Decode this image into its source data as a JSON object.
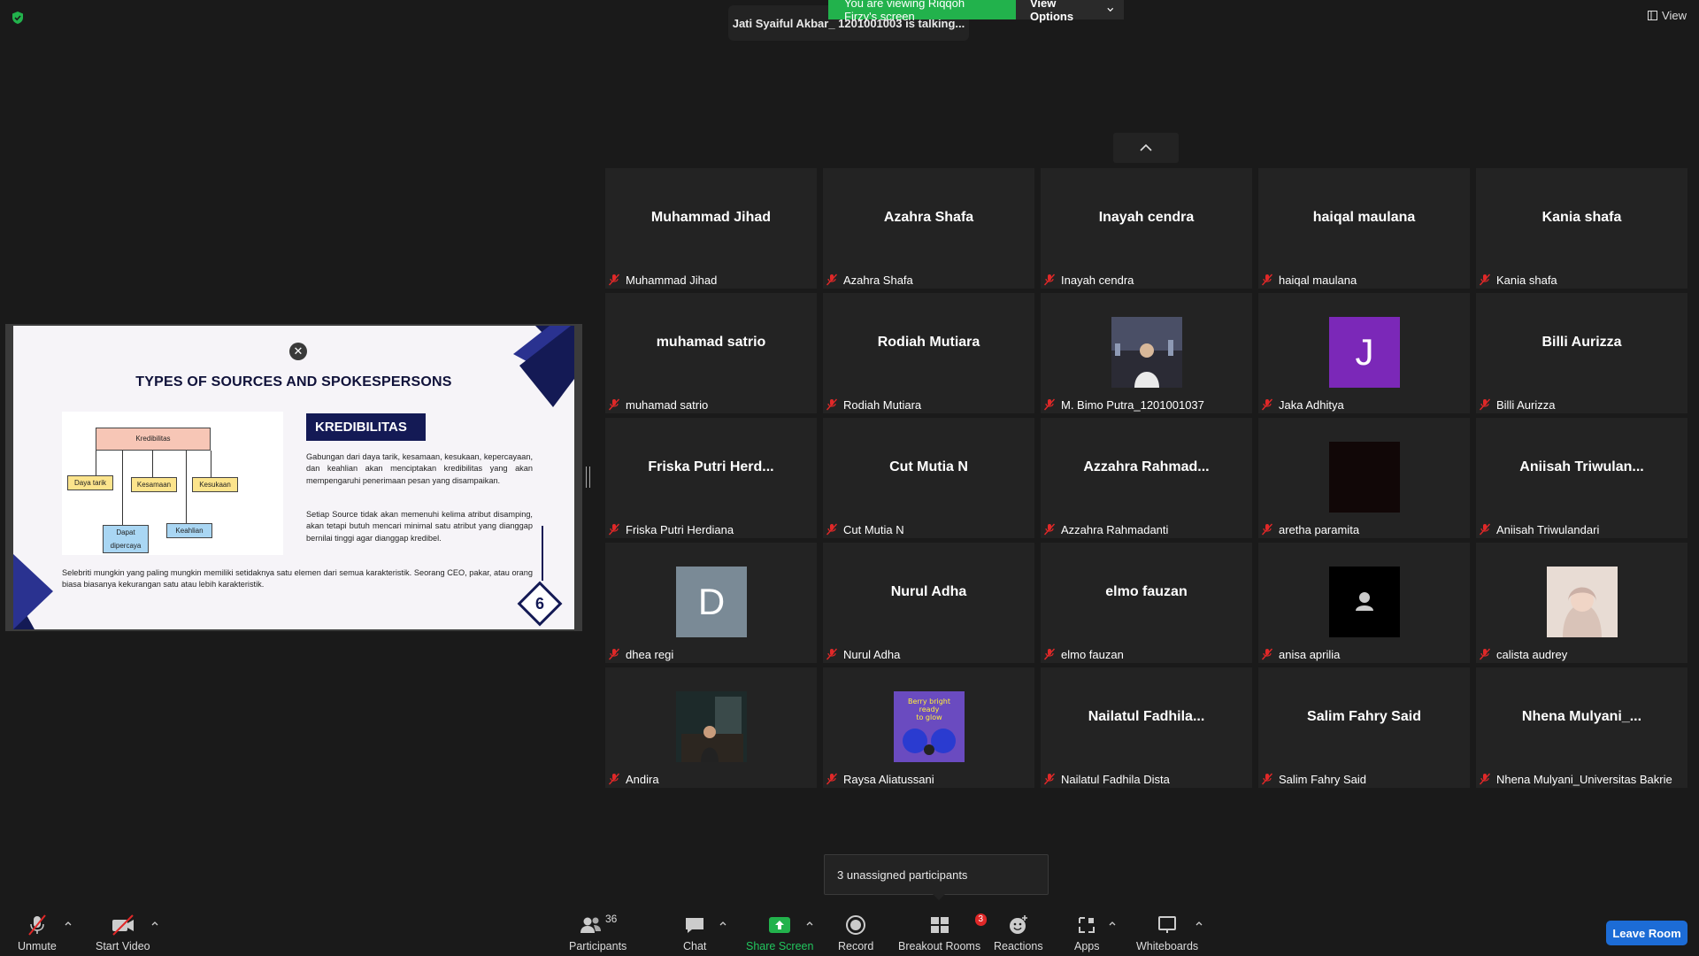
{
  "top": {
    "viewing_text": "You are viewing Riqqoh Firzy's screen",
    "view_options": "View Options",
    "talking_text": "Jati Syaiful Akbar_ 1201001003 is talking...",
    "view_label": "View"
  },
  "slide": {
    "title": "TYPES OF SOURCES AND SPOKESPERSONS",
    "heading": "KREDIBILITAS",
    "para1": "Gabungan dari daya tarik, kesamaan, kesukaan, kepercayaan, dan keahlian akan menciptakan kredibilitas yang akan mempengaruhi penerimaan pesan yang disampaikan.",
    "para2": "Setiap Source tidak akan memenuhi kelima atribut disamping, akan tetapi butuh mencari minimal satu atribut yang dianggap bernilai tinggi agar dianggap kredibel.",
    "bottom": "Selebriti mungkin yang paling mungkin memiliki setidaknya satu elemen dari semua karakteristik. Seorang CEO, pakar, atau orang biasa biasanya kekurangan satu atau lebih karakteristik.",
    "page": "6",
    "diagram": {
      "root": "Kredibilitas",
      "daya_tarik": "Daya tarik",
      "kesamaan": "Kesamaan",
      "kesukaan": "Kesukaan",
      "dapat_dipercaya": "Dapat dipercaya",
      "keahlian": "Keahlian"
    }
  },
  "participants": [
    {
      "big": "Muhammad Jihad",
      "label": "Muhammad Jihad"
    },
    {
      "big": "Azahra Shafa",
      "label": "Azahra Shafa"
    },
    {
      "big": "Inayah cendra",
      "label": "Inayah cendra"
    },
    {
      "big": "haiqal maulana",
      "label": "haiqal maulana"
    },
    {
      "big": "Kania shafa",
      "label": "Kania shafa"
    },
    {
      "big": "muhamad satrio",
      "label": "muhamad satrio"
    },
    {
      "big": "Rodiah Mutiara",
      "label": "Rodiah Mutiara"
    },
    {
      "big": "",
      "label": "M. Bimo Putra_1201001037"
    },
    {
      "big": "",
      "label": "Jaka Adhitya",
      "letter": "J"
    },
    {
      "big": "Billi Aurizza",
      "label": "Billi Aurizza"
    },
    {
      "big": "Friska  Putri  Herd...",
      "label": "Friska Putri Herdiana"
    },
    {
      "big": "Cut Mutia N",
      "label": "Cut Mutia N"
    },
    {
      "big": "Azzahra  Rahmad...",
      "label": "Azzahra Rahmadanti"
    },
    {
      "big": "",
      "label": "aretha paramita"
    },
    {
      "big": "Aniisah  Triwulan...",
      "label": "Aniisah Triwulandari"
    },
    {
      "big": "",
      "label": "dhea regi",
      "letter": "D"
    },
    {
      "big": "Nurul Adha",
      "label": "Nurul Adha"
    },
    {
      "big": "elmo fauzan",
      "label": "elmo fauzan"
    },
    {
      "big": "",
      "label": "anisa aprilia"
    },
    {
      "big": "",
      "label": "calista audrey"
    },
    {
      "big": "",
      "label": "Andira"
    },
    {
      "big": "",
      "label": "Raysa Aliatussani",
      "photo_text": "Berry bright ready to glow"
    },
    {
      "big": "Nailatul  Fadhila...",
      "label": "Nailatul Fadhila Dista"
    },
    {
      "big": "Salim Fahry Said",
      "label": "Salim Fahry Said"
    },
    {
      "big": "Nhena  Mulyani_...",
      "label": "Nhena Mulyani_Universitas Bakrie"
    }
  ],
  "colors": {
    "accent_green": "#22b24c",
    "leave_blue": "#1c6cd6",
    "muted_red": "#e02828",
    "slide_navy": "#141a55",
    "letter_j_bg": "#7b28b8",
    "letter_d_bg": "#7a8a96"
  },
  "tooltip": "3 unassigned participants",
  "toolbar": {
    "unmute": "Unmute",
    "start_video": "Start Video",
    "participants": "Participants",
    "participants_count": "36",
    "chat": "Chat",
    "share_screen": "Share Screen",
    "record": "Record",
    "breakout_rooms": "Breakout Rooms",
    "breakout_badge": "3",
    "reactions": "Reactions",
    "apps": "Apps",
    "whiteboards": "Whiteboards",
    "leave": "Leave Room"
  }
}
